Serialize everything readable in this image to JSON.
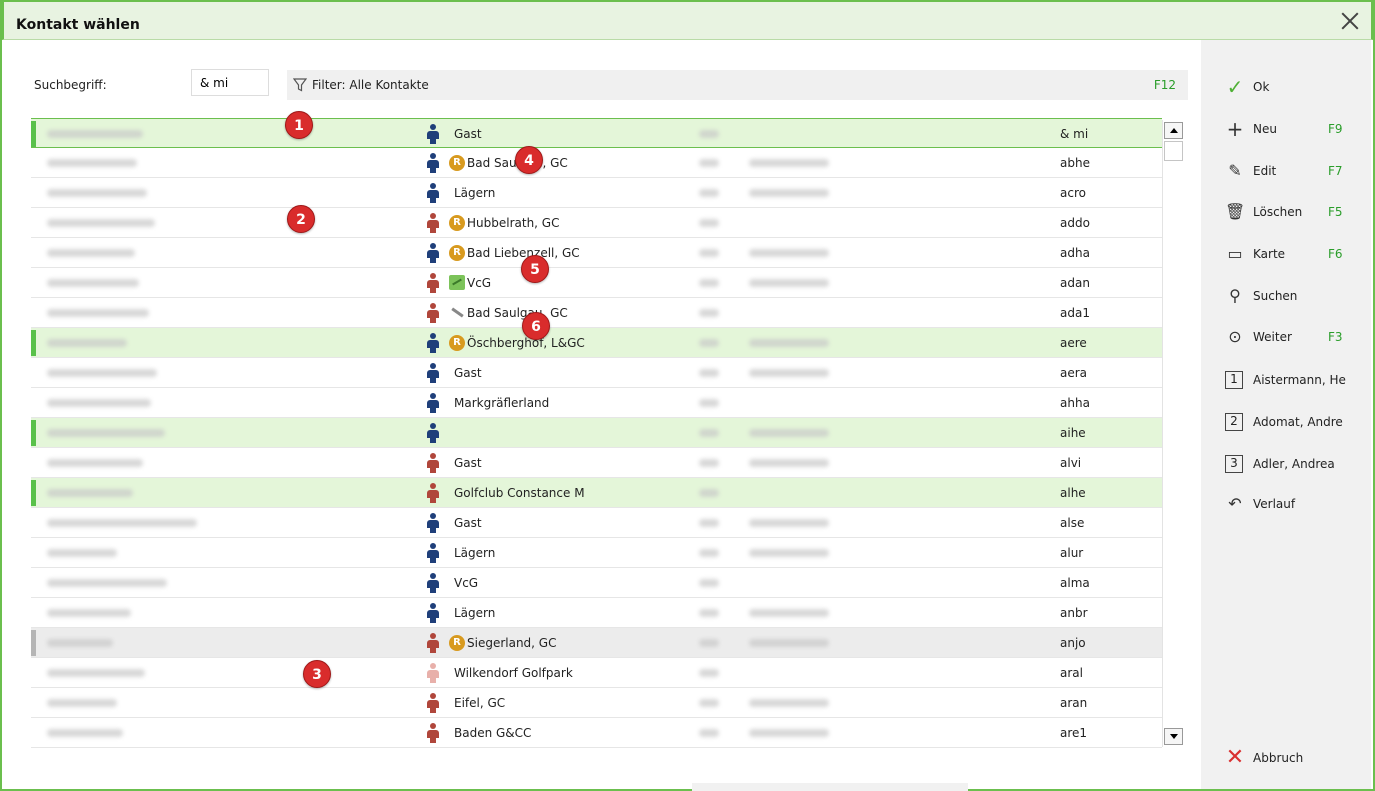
{
  "window": {
    "title": "Kontakt wählen"
  },
  "search": {
    "label": "Suchbegriff:",
    "value": "& mi"
  },
  "filter": {
    "text": "Filter: Alle Kontakte",
    "shortcut": "F12"
  },
  "rows": [
    {
      "club": "Gast",
      "code": "& mi",
      "gender": "m",
      "badge": "",
      "style": "hl focus"
    },
    {
      "club": "Bad Saulgau, GC",
      "code": "abhe",
      "gender": "m",
      "badge": "R",
      "style": ""
    },
    {
      "club": "Lägern",
      "code": "acro",
      "gender": "m",
      "badge": "",
      "style": ""
    },
    {
      "club": "Hubbelrath, GC",
      "code": "addo",
      "gender": "f",
      "badge": "R",
      "style": ""
    },
    {
      "club": "Bad Liebenzell, GC",
      "code": "adha",
      "gender": "m",
      "badge": "R",
      "style": ""
    },
    {
      "club": "VcG",
      "code": "adan",
      "gender": "f",
      "badge": "G",
      "style": ""
    },
    {
      "club": "Bad Saulgau, GC",
      "code": "ada1",
      "gender": "f",
      "badge": "P",
      "style": ""
    },
    {
      "club": "Öschberghof, L&GC",
      "code": "aere",
      "gender": "m",
      "badge": "R",
      "style": "hl"
    },
    {
      "club": "Gast",
      "code": "aera",
      "gender": "m",
      "badge": "",
      "style": ""
    },
    {
      "club": "Markgräflerland",
      "code": "ahha",
      "gender": "m",
      "badge": "",
      "style": ""
    },
    {
      "club": "",
      "code": "aihe",
      "gender": "m",
      "badge": "",
      "style": "hl"
    },
    {
      "club": "Gast",
      "code": "alvi",
      "gender": "f",
      "badge": "",
      "style": ""
    },
    {
      "club": "Golfclub Constance M",
      "code": "alhe",
      "gender": "f",
      "badge": "",
      "style": "hl"
    },
    {
      "club": "Gast",
      "code": "alse",
      "gender": "m",
      "badge": "",
      "style": ""
    },
    {
      "club": "Lägern",
      "code": "alur",
      "gender": "m",
      "badge": "",
      "style": ""
    },
    {
      "club": "VcG",
      "code": "alma",
      "gender": "m",
      "badge": "",
      "style": ""
    },
    {
      "club": "Lägern",
      "code": "anbr",
      "gender": "m",
      "badge": "",
      "style": ""
    },
    {
      "club": "Siegerland, GC",
      "code": "anjo",
      "gender": "f",
      "badge": "R",
      "style": "sel"
    },
    {
      "club": "Wilkendorf Golfpark",
      "code": "aral",
      "gender": "fl",
      "badge": "",
      "style": ""
    },
    {
      "club": "Eifel, GC",
      "code": "aran",
      "gender": "f",
      "badge": "",
      "style": ""
    },
    {
      "club": "Baden G&CC",
      "code": "are1",
      "gender": "f",
      "badge": "",
      "style": ""
    }
  ],
  "markers": [
    "1",
    "2",
    "3",
    "4",
    "5",
    "6"
  ],
  "sidebar": {
    "ok": {
      "label": "Ok",
      "icon": "check-icon"
    },
    "neu": {
      "label": "Neu",
      "key": "F9",
      "icon": "plus-icon"
    },
    "edit": {
      "label": "Edit",
      "key": "F7",
      "icon": "pencil-icon"
    },
    "loeschen": {
      "label": "Löschen",
      "key": "F5",
      "icon": "trash-icon"
    },
    "karte": {
      "label": "Karte",
      "key": "F6",
      "icon": "card-icon"
    },
    "suchen": {
      "label": "Suchen",
      "icon": "search-icon"
    },
    "weiter": {
      "label": "Weiter",
      "key": "F3",
      "icon": "next-icon"
    },
    "recent1": {
      "num": "1",
      "label": "Aistermann, He"
    },
    "recent2": {
      "num": "2",
      "label": "Adomat, Andre"
    },
    "recent3": {
      "num": "3",
      "label": "Adler, Andrea"
    },
    "verlauf": {
      "label": "Verlauf",
      "icon": "undo-icon"
    },
    "abbruch": {
      "label": "Abbruch",
      "icon": "cross-icon"
    }
  },
  "colors": {
    "accent": "#6bbf4e",
    "highlight": "#e4f6d9",
    "marker": "#d92c2c",
    "shortcut": "#2a9d2a"
  }
}
